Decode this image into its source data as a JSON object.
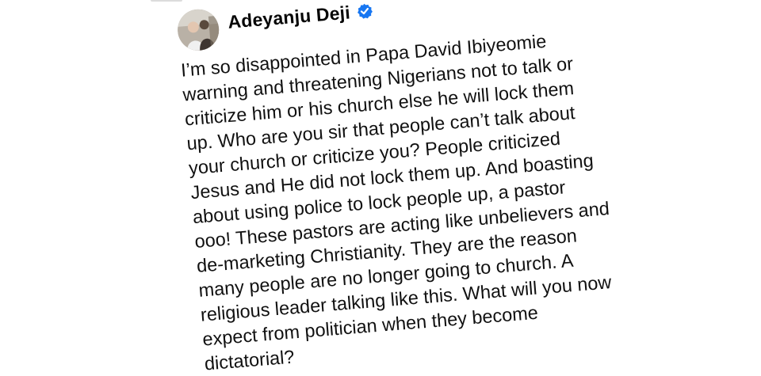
{
  "post": {
    "author": {
      "name": "Adeyanju Deji",
      "verified": true,
      "avatar_icon": "profile-photo"
    },
    "text_lines": [
      "I’m so disappointed in Papa David Ibiyeomie",
      "warning and threatening Nigerians not to talk or",
      "criticize him or his church else he will lock them",
      "up. Who are you sir that people can’t talk about",
      "your church or criticize you? People criticized",
      "Jesus and He did not lock them up. And boasting",
      "about using police to lock people up, a pastor",
      "ooo! These pastors are acting like unbelievers and",
      "de-marketing Christianity. They are the reason",
      "many people are no longer going to church. A",
      "religious leader talking like this. What will you now",
      "expect from politician when they become",
      "dictatorial?"
    ]
  },
  "colors": {
    "background": "#ffffff",
    "text": "#111111",
    "verified_badge": "#1877f2"
  }
}
